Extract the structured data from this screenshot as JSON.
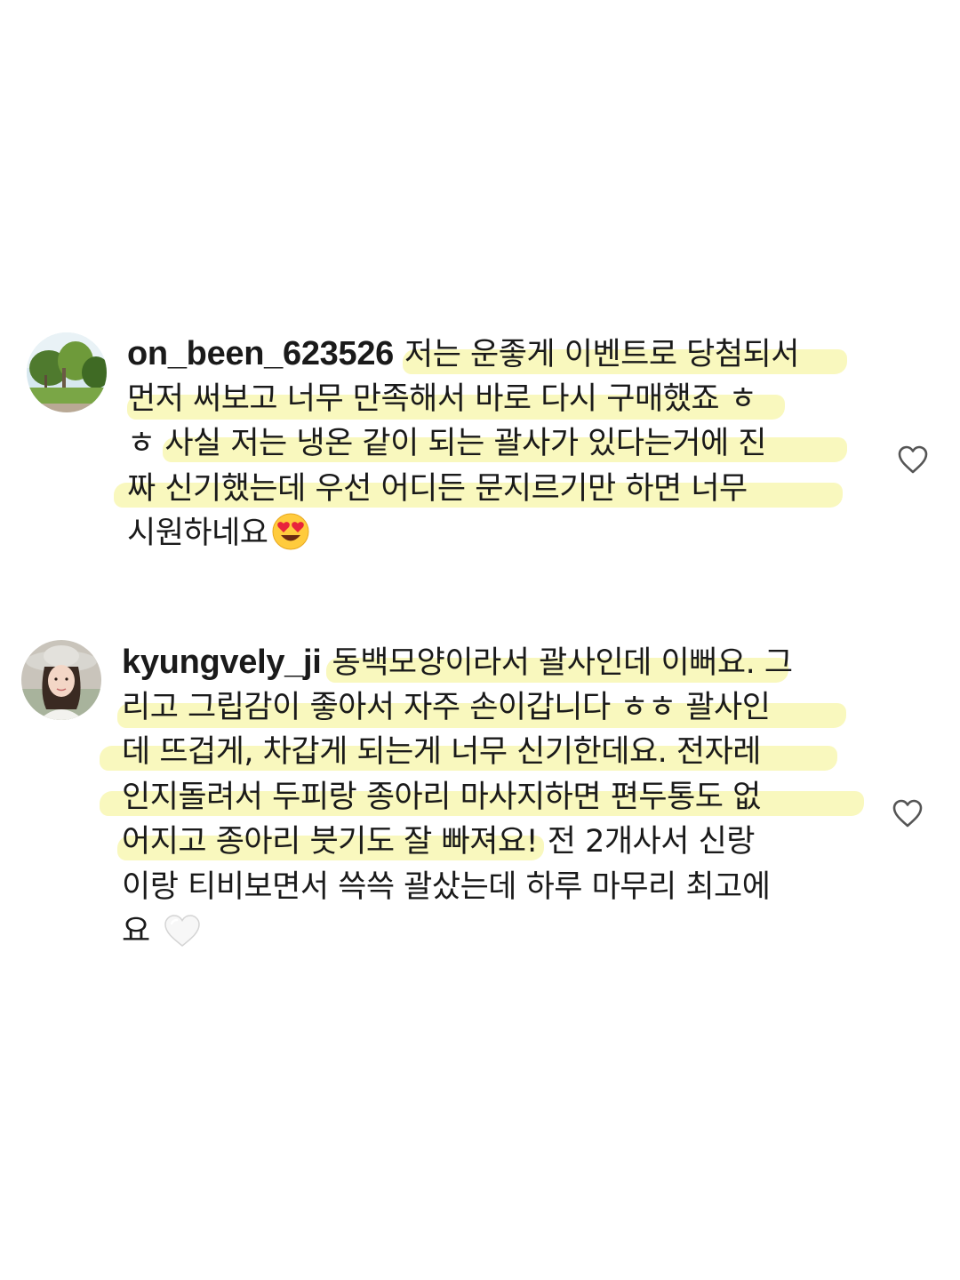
{
  "comments": [
    {
      "username": "on_been_623526",
      "lines": [
        "저는 운좋게 이벤트로 당첨되서",
        "먼저 써보고 너무 만족해서 바로 다시 구매했죠 ㅎ",
        "ㅎ 사실 저는 냉온 같이 되는 괄사가 있다는거에 진",
        "짜 신기했는데 우선 어디든 문지르기만 하면 너무",
        "시원하네요"
      ],
      "end_emoji": "heart-eyes-emoji",
      "avatar_icon": "forest-photo-avatar",
      "like_icon": "heart-outline-icon"
    },
    {
      "username": "kyungvely_ji",
      "lines": [
        "동백모양이라서 괄사인데 이뻐요. 그",
        "리고 그립감이 좋아서 자주 손이갑니다 ㅎㅎ 괄사인",
        "데 뜨겁게, 차갑게 되는게 너무 신기한데요. 전자레",
        "인지돌려서 두피랑 종아리 마사지하면 편두통도 없",
        "어지고 종아리 붓기도 잘 빠져요! 전 2개사서 신랑",
        "이랑 티비보면서 쓱쓱 괄샀는데 하루 마무리 최고에",
        "요"
      ],
      "end_emoji": "white-heart-emoji",
      "avatar_icon": "woman-in-hat-avatar",
      "like_icon": "heart-outline-icon"
    }
  ],
  "colors": {
    "highlight": "#f6f396",
    "text": "#1a1a1a",
    "icon": "#555555"
  }
}
